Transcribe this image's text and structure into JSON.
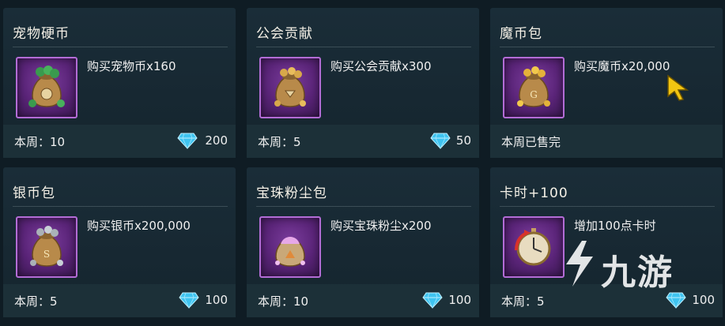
{
  "colors": {
    "card_bg": "#172832",
    "frame_border": "#b36cd6",
    "frame_bg": "#5a2478",
    "gem": "#3fc4f0"
  },
  "shop": {
    "items": [
      {
        "title": "宠物硬币",
        "desc": "购买宠物币x160",
        "limit": "本周：10",
        "price": "200",
        "icon": "pet-coin-bag-icon"
      },
      {
        "title": "公会贡献",
        "desc": "购买公会贡献x300",
        "limit": "本周：5",
        "price": "50",
        "icon": "guild-contribution-bag-icon"
      },
      {
        "title": "魔币包",
        "desc": "购买魔币x20,000",
        "limit": "本周已售完",
        "price": "",
        "icon": "magic-coin-bag-icon"
      },
      {
        "title": "银币包",
        "desc": "购买银币x200,000",
        "limit": "本周：5",
        "price": "100",
        "icon": "silver-coin-bag-icon"
      },
      {
        "title": "宝珠粉尘包",
        "desc": "购买宝珠粉尘x200",
        "limit": "本周：10",
        "price": "100",
        "icon": "gem-dust-bag-icon"
      },
      {
        "title": "卡时+100",
        "desc": "增加100点卡时",
        "limit": "本周：5",
        "price": "100",
        "icon": "stopwatch-icon"
      }
    ]
  },
  "watermark": {
    "text": "九游"
  }
}
